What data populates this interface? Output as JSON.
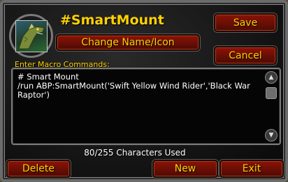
{
  "macro": {
    "name": "#SmartMount",
    "icon": "raptor-mount-icon"
  },
  "buttons": {
    "save": "Save",
    "change_name_icon": "Change Name/Icon",
    "cancel": "Cancel",
    "delete": "Delete",
    "new": "New",
    "exit": "Exit"
  },
  "editor": {
    "label": "Enter Macro Commands:",
    "text": "# Smart Mount\n/run ABP:SmartMount('Swift Yellow Wind Rider','Black War Raptor')",
    "scroll_up_icon": "scroll-up-icon",
    "scroll_down_icon": "scroll-down-icon"
  },
  "status": {
    "chars_used": "80/255 Characters Used"
  },
  "colors": {
    "gold_text": "#ffd200",
    "button_red": "#6b0f05",
    "panel_bg": "#111111"
  }
}
